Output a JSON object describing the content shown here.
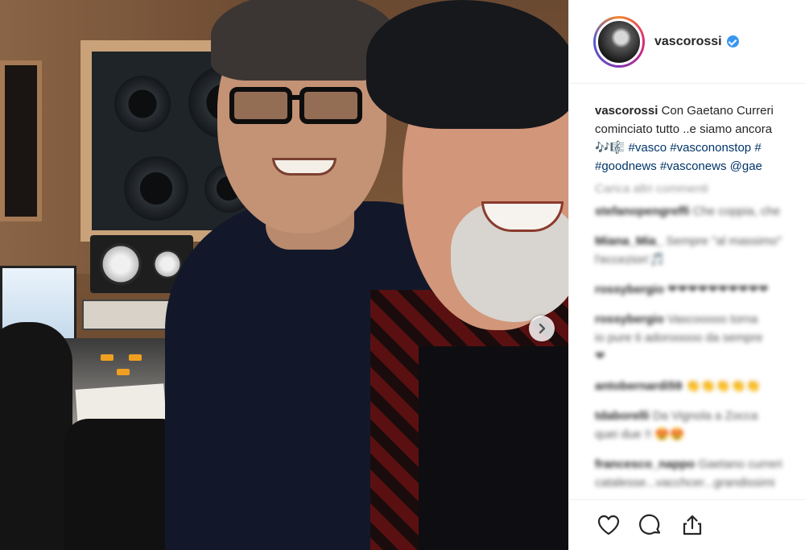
{
  "post": {
    "username": "vascorossi",
    "verified": true,
    "caption": {
      "user": "vascorossi",
      "line1": "Con Gaetano Curreri",
      "line2": "cominciato tutto ..e siamo ancora",
      "line3_emoji": "🎶🎼",
      "tags": [
        "#vasco",
        "#vascononstop",
        "#",
        "#goodnews",
        "#vasconews",
        "@gae"
      ]
    },
    "load_more": "Carica altri commenti"
  },
  "comments": [
    {
      "user": "stefanopengreffi",
      "text": "Che coppia, che"
    },
    {
      "user": "Miana_Mia_",
      "text": "Sempre ''al massimo''"
    },
    {
      "user": "",
      "text": "l'eccezion'🎵"
    },
    {
      "user": "rossybergio",
      "text": "❤❤❤❤❤❤❤❤❤❤"
    },
    {
      "user": "rossybergio",
      "text": "Vascooooo torna"
    },
    {
      "user": "",
      "text": "io pure ti adorooooo da sempre"
    },
    {
      "user": "",
      "text": "❤"
    },
    {
      "user": "antobernardi59",
      "text": "👏👏👏👏👏"
    },
    {
      "user": "tdaborelli",
      "text": "Da Vignola a Zocca"
    },
    {
      "user": "",
      "text": "quei due !! 😍😍"
    },
    {
      "user": "francesco_nappo",
      "text": "Gaetano curreri"
    },
    {
      "user": "",
      "text": "catalesse...vacchcer...grandissimi"
    }
  ],
  "actions": {
    "like": "heart-icon",
    "comment": "comment-bubble-icon",
    "share": "share-icon"
  },
  "colors": {
    "link": "#003569",
    "verified": "#3897f0",
    "border": "#efefef"
  }
}
